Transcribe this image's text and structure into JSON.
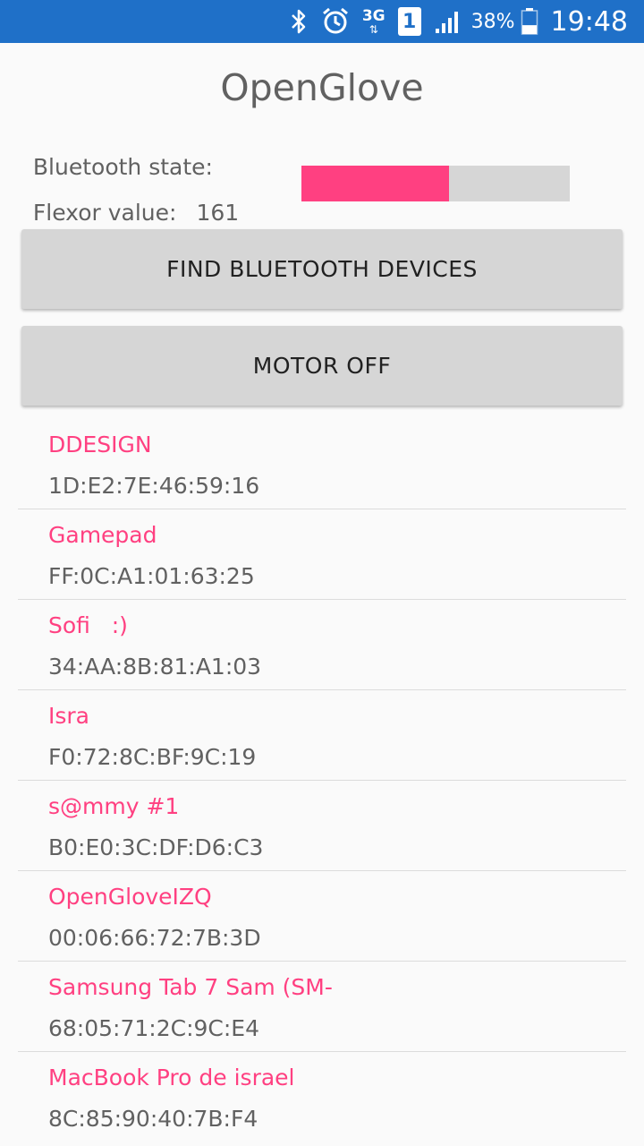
{
  "status_bar": {
    "network_label": "3G",
    "sim_label": "1",
    "battery_percent": "38%",
    "time": "19:48",
    "icons": [
      "bluetooth-icon",
      "alarm-icon",
      "network-3g-icon",
      "sim-icon",
      "signal-icon",
      "battery-icon"
    ],
    "battery_level": 0.38
  },
  "app": {
    "title": "OpenGlove",
    "bluetooth_state_label": "Bluetooth state:",
    "bluetooth_state_value": "",
    "flexor_label": "Flexor value:",
    "flexor_value": "161",
    "flexor_progress_fraction": 0.55,
    "colors": {
      "accent": "#ff4081",
      "status_bar": "#1f70c8",
      "button": "#d6d6d6"
    }
  },
  "buttons": {
    "find_devices": "FIND BLUETOOTH DEVICES",
    "motor": "MOTOR OFF"
  },
  "devices": [
    {
      "name": "DDESIGN",
      "address": "1D:E2:7E:46:59:16"
    },
    {
      "name": "Gamepad",
      "address": "FF:0C:A1:01:63:25"
    },
    {
      "name": "Sofi   :)",
      "address": "34:AA:8B:81:A1:03"
    },
    {
      "name": "Isra",
      "address": "F0:72:8C:BF:9C:19"
    },
    {
      "name": "s@mmy #1",
      "address": "B0:E0:3C:DF:D6:C3"
    },
    {
      "name": "OpenGloveIZQ",
      "address": "00:06:66:72:7B:3D"
    },
    {
      "name": "Samsung Tab 7 Sam (SM-",
      "address": "68:05:71:2C:9C:E4"
    },
    {
      "name": "MacBook Pro de israel",
      "address": "8C:85:90:40:7B:F4"
    }
  ]
}
